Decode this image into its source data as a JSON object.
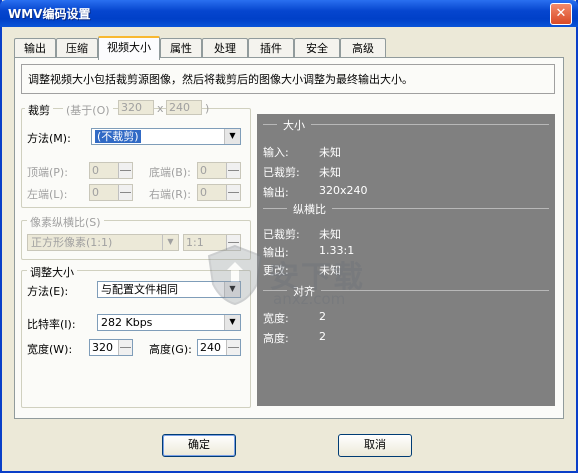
{
  "window": {
    "title": "WMV编码设置",
    "close_label": "✕"
  },
  "tabs": [
    {
      "label": "输出"
    },
    {
      "label": "压缩"
    },
    {
      "label": "视频大小",
      "active": true
    },
    {
      "label": "属性"
    },
    {
      "label": "处理"
    },
    {
      "label": "插件"
    },
    {
      "label": "安全"
    },
    {
      "label": "高级"
    }
  ],
  "description": "调整视频大小包括裁剪源图像，然后将裁剪后的图像大小调整为最终输出大小。",
  "crop": {
    "legend": "裁剪",
    "base_label": "(基于(O)",
    "base_w": "320",
    "base_x": "x",
    "base_h": "240",
    "base_close": ")",
    "method_label": "方法(M):",
    "method_value": "(不裁剪)",
    "top_label": "顶端(P):",
    "top_value": "0",
    "bottom_label": "底端(B):",
    "bottom_value": "0",
    "left_label": "左端(L):",
    "left_value": "0",
    "right_label": "右端(R):",
    "right_value": "0"
  },
  "aspect": {
    "legend": "像素纵横比(S)",
    "value": "正方形像素(1:1)",
    "extra_value": "1:1"
  },
  "resize": {
    "legend": "调整大小",
    "method_label": "方法(E):",
    "method_value": "与配置文件相同",
    "bitrate_label": "比特率(I):",
    "bitrate_value": "282 Kbps",
    "width_label": "宽度(W):",
    "width_value": "320",
    "height_label": "高度(G):",
    "height_value": "240"
  },
  "info": {
    "size_head": "大小",
    "input_label": "输入:",
    "input_value": "未知",
    "cropped_label": "已裁剪:",
    "cropped_value": "未知",
    "output_label": "输出:",
    "output_value": "320x240",
    "aspect_head": "纵横比",
    "a_cropped_label": "已裁剪:",
    "a_cropped_value": "未知",
    "a_output_label": "输出:",
    "a_output_value": "1.33:1",
    "a_changed_label": "更改:",
    "a_changed_value": "未知",
    "align_head": "对齐",
    "align_width_label": "宽度:",
    "align_width_value": "2",
    "align_height_label": "高度:",
    "align_height_value": "2"
  },
  "buttons": {
    "ok": "确定",
    "cancel": "取消"
  },
  "watermark": {
    "text": "安下载",
    "sub": "anxz.com"
  }
}
